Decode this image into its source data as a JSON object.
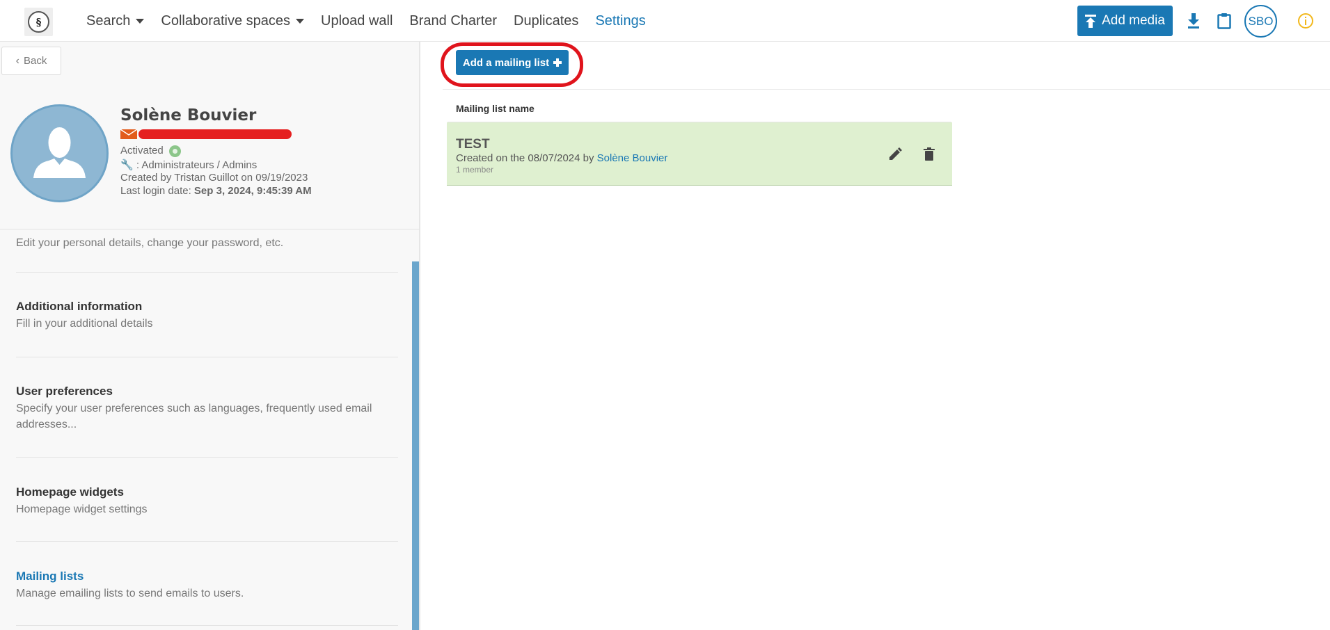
{
  "header": {
    "nav": [
      {
        "label": "Search",
        "dropdown": true
      },
      {
        "label": "Collaborative spaces",
        "dropdown": true
      },
      {
        "label": "Upload wall",
        "dropdown": false
      },
      {
        "label": "Brand Charter",
        "dropdown": false
      },
      {
        "label": "Duplicates",
        "dropdown": false
      },
      {
        "label": "Settings",
        "dropdown": false,
        "active": true
      }
    ],
    "add_media_label": "Add media",
    "user_initials": "SBO",
    "icons": [
      "download-icon",
      "clipboard-icon",
      "info-icon"
    ],
    "accent_color": "#1a78b4"
  },
  "sidebar": {
    "back_label": "Back",
    "profile": {
      "name": "Solène Bouvier",
      "status": "Activated",
      "role": ": Administrateurs / Admins",
      "created": "Created by Tristan Guillot on 09/19/2023",
      "last_login_prefix": "Last login date: ",
      "last_login_value": "Sep 3, 2024, 9:45:39 AM"
    },
    "items": [
      {
        "title": "",
        "desc": "Edit your personal details, change your password, etc."
      },
      {
        "title": "Additional information",
        "desc": "Fill in your additional details"
      },
      {
        "title": "User preferences",
        "desc": "Specify your user preferences such as languages, frequently used email addresses..."
      },
      {
        "title": "Homepage widgets",
        "desc": "Homepage widget settings"
      },
      {
        "title": "Mailing lists",
        "desc": "Manage emailing lists to send emails to users.",
        "active": true
      }
    ]
  },
  "main": {
    "add_button_label": "Add a mailing list",
    "column_header": "Mailing list name",
    "rows": [
      {
        "name": "TEST",
        "created_prefix": "Created on the 08/07/2024 by ",
        "created_by": "Solène Bouvier",
        "members": "1 member"
      }
    ]
  }
}
